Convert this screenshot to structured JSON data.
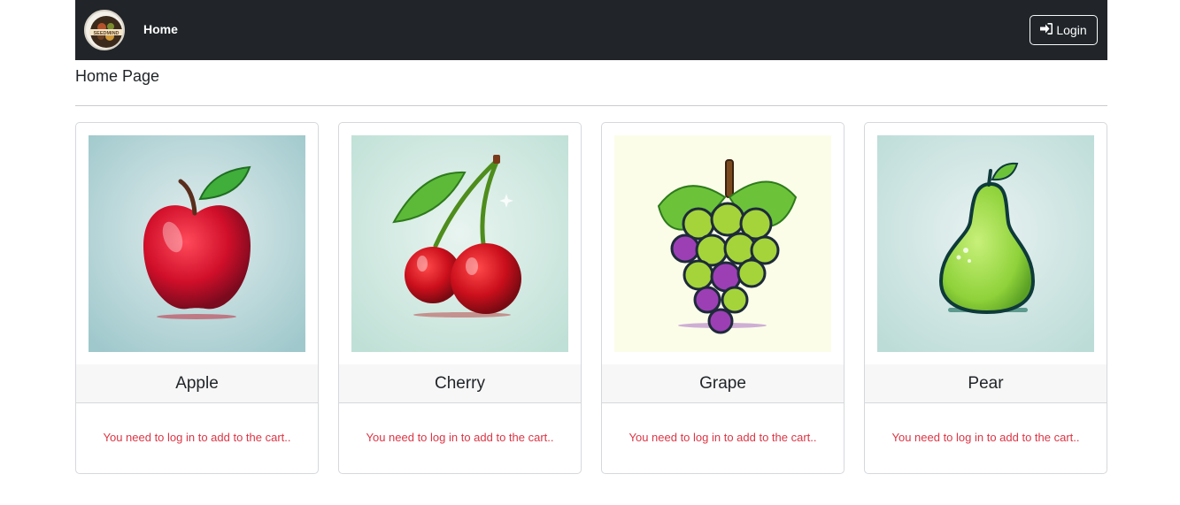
{
  "nav": {
    "home_label": "Home",
    "login_label": "Login",
    "logo_text": "SEEDMIND"
  },
  "page": {
    "title": "Home Page"
  },
  "products": [
    {
      "name": "Apple",
      "message": "You need to log in to add to the cart..",
      "icon": "apple-image"
    },
    {
      "name": "Cherry",
      "message": "You need to log in to add to the cart..",
      "icon": "cherry-image"
    },
    {
      "name": "Grape",
      "message": "You need to log in to add to the cart..",
      "icon": "grape-image"
    },
    {
      "name": "Pear",
      "message": "You need to log in to add to the cart..",
      "icon": "pear-image"
    }
  ],
  "colors": {
    "navbar": "#212529",
    "warning_text": "#dc3545",
    "card_header": "#f7f7f7"
  }
}
